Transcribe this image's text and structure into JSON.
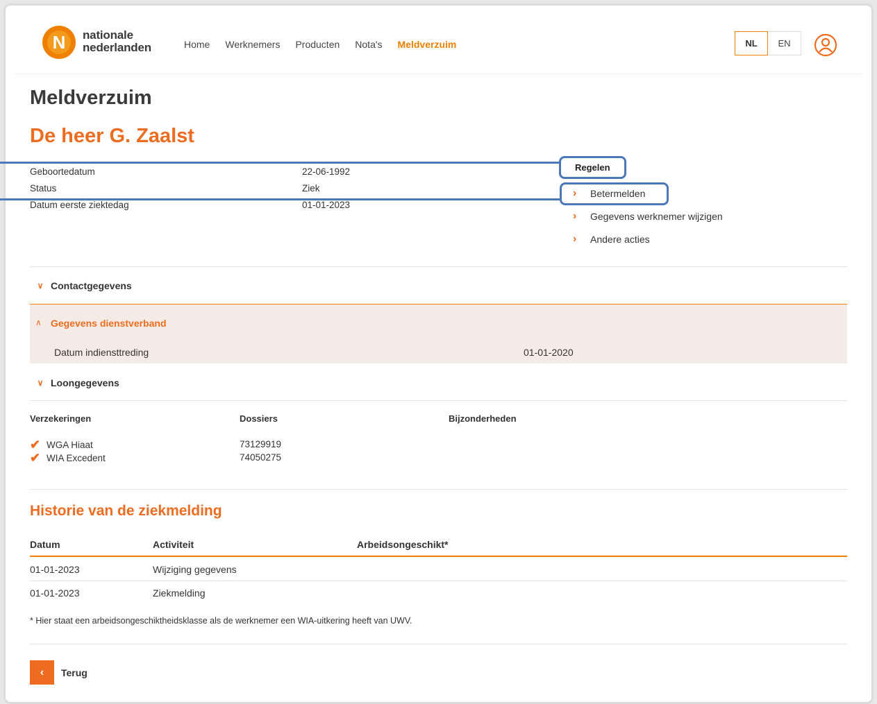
{
  "brand": {
    "line1": "nationale",
    "line2": "nederlanden",
    "accent": "#ee7f00",
    "accent_dark": "#ee6c1f"
  },
  "nav": [
    "Home",
    "Werknemers",
    "Producten",
    "Nota's",
    "Meldverzuim"
  ],
  "lang": {
    "nl": "NL",
    "en": "EN"
  },
  "page_title": "Meldverzuim",
  "person_name": "De heer G. Zaalst",
  "details": [
    {
      "label": "Geboortedatum",
      "value": "22-06-1992"
    },
    {
      "label": "Status",
      "value": "Ziek"
    },
    {
      "label": "Datum eerste ziektedag",
      "value": "01-01-2023"
    }
  ],
  "actions": {
    "title": "Regelen",
    "items": [
      "Betermelden",
      "Gegevens werknemer wijzigen",
      "Andere acties"
    ]
  },
  "accordions": {
    "contact": "Contactgegevens",
    "dienstverband": "Gegevens dienstverband",
    "dienst_label": "Datum indiensttreding",
    "dienst_value": "01-01-2020",
    "loon": "Loongegevens"
  },
  "insurance": {
    "col1": "Verzekeringen",
    "col2": "Dossiers",
    "col3": "Bijzonderheden",
    "items": [
      "WGA Hiaat",
      "WIA Excedent"
    ],
    "dossiers": [
      "73129919",
      "74050275"
    ]
  },
  "history": {
    "title": "Historie van de ziekmelding",
    "headers": [
      "Datum",
      "Activiteit",
      "Arbeidsongeschikt*"
    ],
    "rows": [
      {
        "date": "01-01-2023",
        "activity": "Wijziging gegevens"
      },
      {
        "date": "01-01-2023",
        "activity": "Ziekmelding"
      }
    ],
    "footnote": "* Hier staat een arbeidsongeschiktheidsklasse als de werknemer een WIA-uitkering heeft van UWV."
  },
  "back_label": "Terug",
  "icons": [
    "chevron-right-icon",
    "chevron-down-icon",
    "chevron-up-icon",
    "check-icon",
    "user-icon",
    "chevron-left-icon"
  ]
}
